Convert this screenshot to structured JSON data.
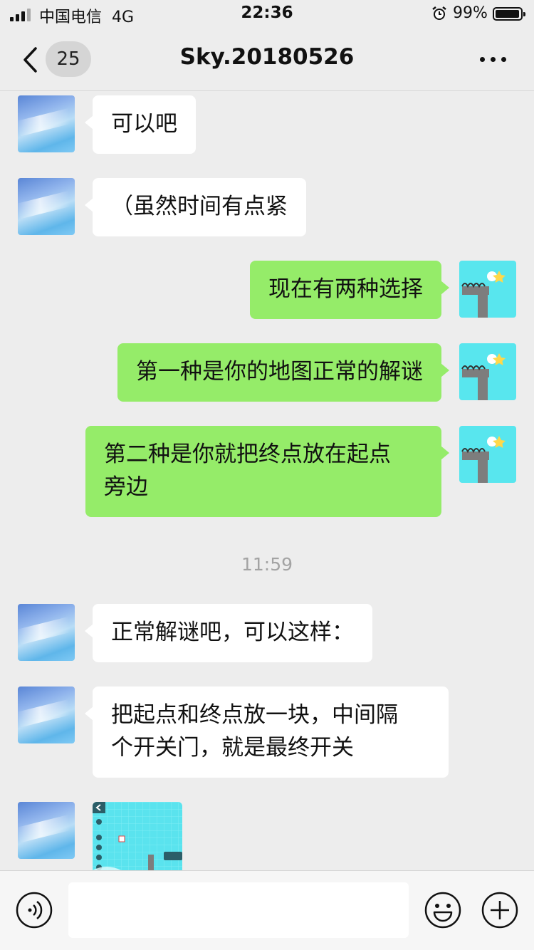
{
  "status_bar": {
    "carrier": "中国电信",
    "network": "4G",
    "time": "22:36",
    "battery_percent": "99%",
    "battery_level": 0.99
  },
  "header": {
    "unread_count": "25",
    "title": "Sky.20180526"
  },
  "messages": [
    {
      "side": "in",
      "text": "可以吧"
    },
    {
      "side": "in",
      "text": "（虽然时间有点紧"
    },
    {
      "side": "out",
      "text": "现在有两种选择"
    },
    {
      "side": "out",
      "text": "第一种是你的地图正常的解谜"
    },
    {
      "side": "out",
      "text": "第二种是你就把终点放在起点\n旁边"
    },
    {
      "side": "in",
      "text": "正常解谜吧，可以这样："
    },
    {
      "side": "in",
      "text": "把起点和终点放一块，中间隔\n个开关门，就是最终开关"
    }
  ],
  "timestamp": "11:59",
  "input": {
    "placeholder": "",
    "value": ""
  },
  "icons": {
    "back": "chevron-left-icon",
    "more": "more-dots-icon",
    "voice": "voice-icon",
    "emoji": "emoji-icon",
    "plus": "plus-icon",
    "alarm": "alarm-icon"
  },
  "colors": {
    "outgoing_bubble": "#95ec69",
    "incoming_bubble": "#ffffff",
    "background": "#ededed"
  }
}
